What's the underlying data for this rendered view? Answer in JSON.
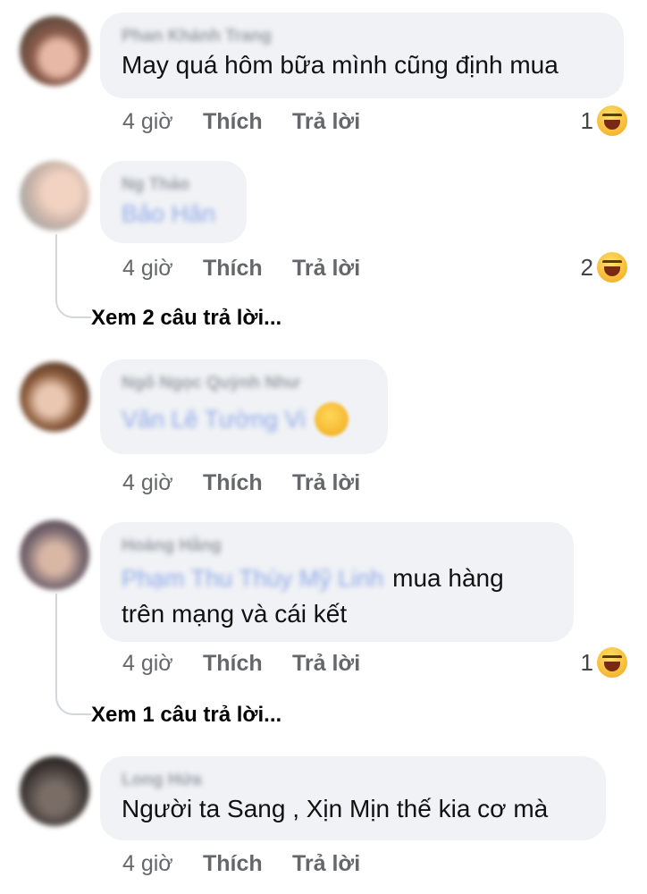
{
  "comments": [
    {
      "author": "Phan Khánh Trang",
      "text": "May quá hôm bữa mình cũng định mua",
      "time": "4 giờ",
      "like": "Thích",
      "reply": "Trả lời",
      "reaction_count": "1",
      "reaction_icon": "laugh-icon"
    },
    {
      "author": "Ng Thảo",
      "tag": "Bảo Hân",
      "time": "4 giờ",
      "like": "Thích",
      "reply": "Trả lời",
      "reaction_count": "2",
      "reaction_icon": "laugh-icon",
      "view_replies": "Xem 2 câu trả lời..."
    },
    {
      "author": "Ngô Ngọc Quỳnh Như",
      "tag": "Văn Lê Tường Vi",
      "time": "4 giờ",
      "like": "Thích",
      "reply": "Trả lời"
    },
    {
      "author": "Hoàng Hằng",
      "tag": "Phạm Thu Thùy Mỹ Linh",
      "text_inline": "mua hàng",
      "text_line2": "trên mạng và cái kết",
      "time": "4 giờ",
      "like": "Thích",
      "reply": "Trả lời",
      "reaction_count": "1",
      "reaction_icon": "laugh-icon",
      "view_replies": "Xem 1 câu trả lời..."
    },
    {
      "author": "Long Hứa",
      "text": "Người ta Sang , Xịn Mịn thế kia cơ mà",
      "time": "4 giờ",
      "like": "Thích",
      "reply": "Trả lời"
    }
  ],
  "colors": {
    "bubble": "#f0f2f5",
    "meta": "#65676b",
    "tag": "#8ea8e8"
  }
}
